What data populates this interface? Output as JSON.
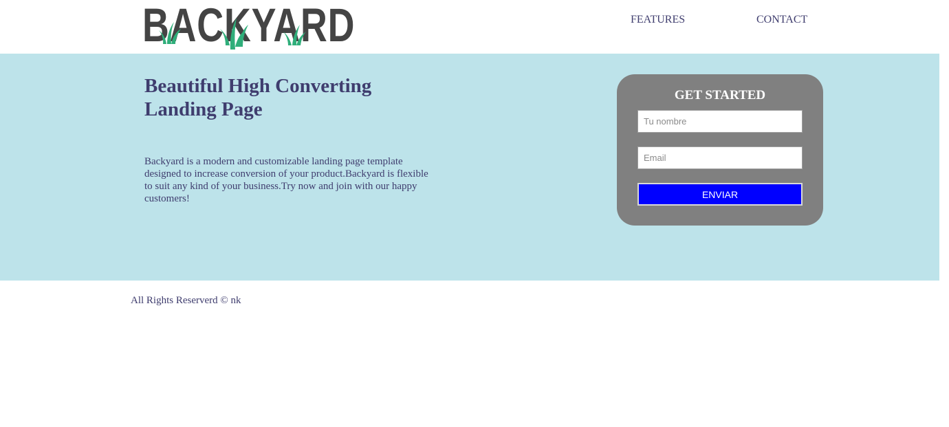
{
  "brand": {
    "logo_text": "BACKYARD",
    "text_color": "#444444",
    "grass_color": "#2fae7a"
  },
  "nav": {
    "features_label": "FEATURES",
    "contact_label": "CONTACT"
  },
  "hero": {
    "title": "Beautiful High Converting Landing Page",
    "description": "Backyard is a modern and customizable landing page template designed to increase conversion of your product.Backyard is flexible to suit any kind of your business.Try now and join with our happy customers!",
    "background_color": "#bde3ea"
  },
  "signup_form": {
    "title": "GET STARTED",
    "name_placeholder": "Tu nombre",
    "name_value": "",
    "email_placeholder": "Email",
    "email_value": "",
    "submit_label": "ENVIAR",
    "card_color": "#808080",
    "button_color": "#0000ff"
  },
  "footer": {
    "copyright": "All Rights Reserverd © nk"
  }
}
